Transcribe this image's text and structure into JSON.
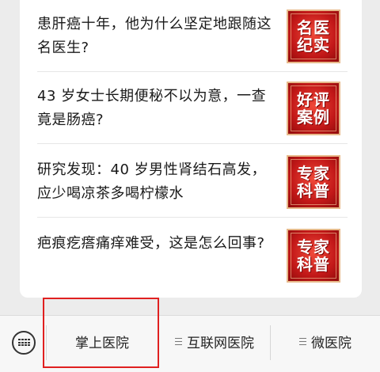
{
  "articles": [
    {
      "title": "患肝癌十年，他为什么坚定地跟随这名医生?",
      "thumb_line1": "名医",
      "thumb_line2": "纪实"
    },
    {
      "title": "43 岁女士长期便秘不以为意，一查竟是肠癌?",
      "thumb_line1": "好评",
      "thumb_line2": "案例"
    },
    {
      "title": "研究发现：40 岁男性肾结石高发，应少喝凉茶多喝柠檬水",
      "thumb_line1": "专家",
      "thumb_line2": "科普"
    },
    {
      "title": "疤痕疙瘩痛痒难受，这是怎么回事?",
      "thumb_line1": "专家",
      "thumb_line2": "科普"
    }
  ],
  "tabbar": {
    "keyboard_icon": "keyboard-icon",
    "tab1_label": "掌上医院",
    "tab2_label": "互联网医院",
    "tab3_label": "微医院",
    "menu_icon": "menu-icon"
  },
  "colors": {
    "thumb_red": "#c21818",
    "highlight_border": "#e02020"
  }
}
